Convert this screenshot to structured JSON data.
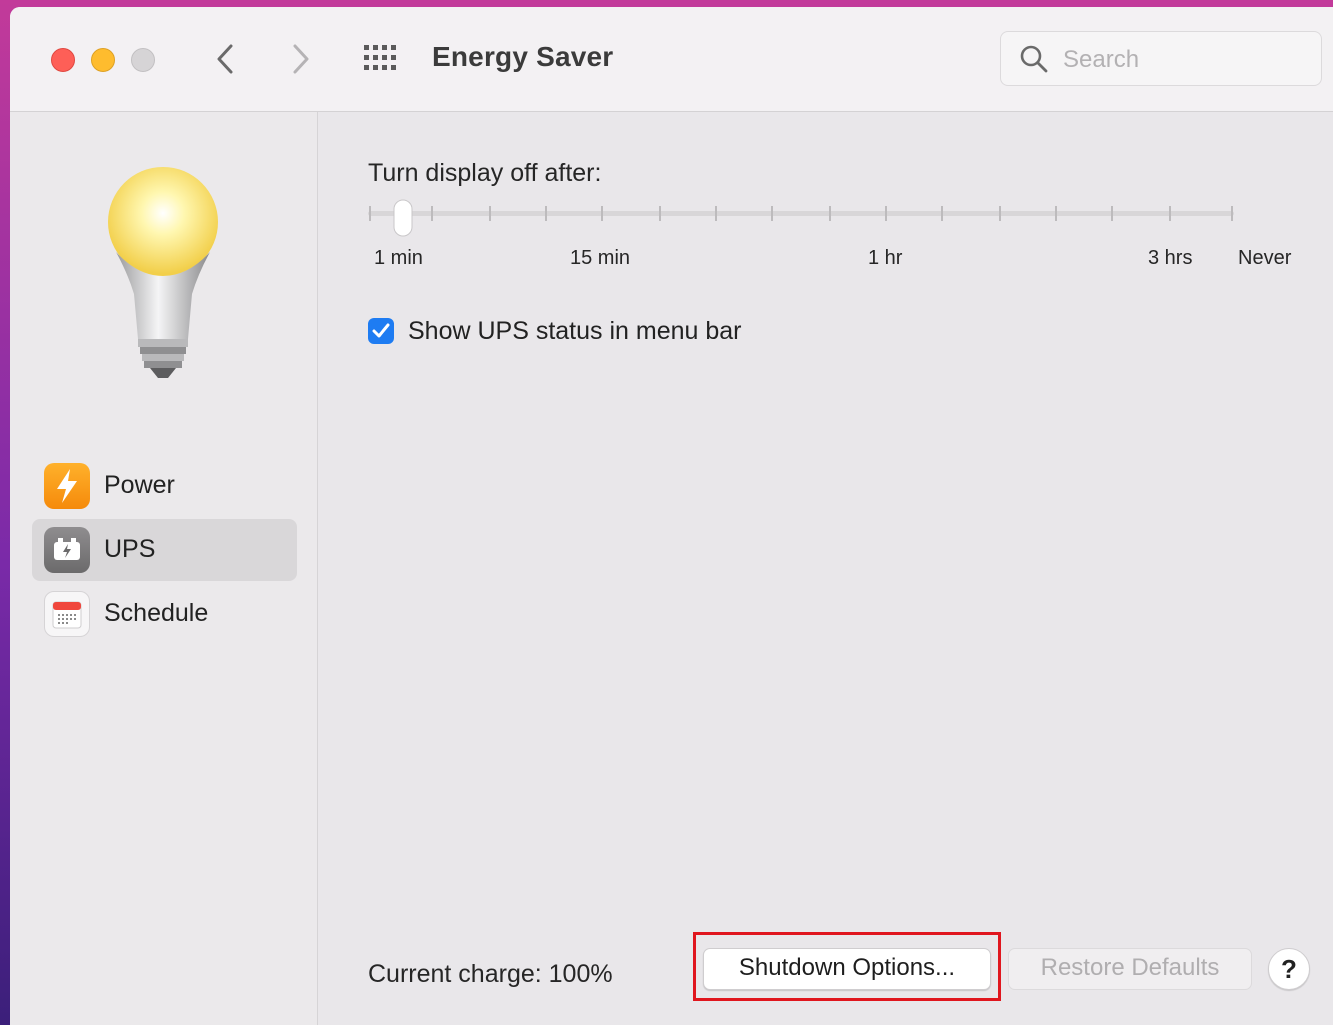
{
  "window": {
    "title": "Energy Saver",
    "search_placeholder": "Search"
  },
  "sidebar": {
    "items": [
      {
        "label": "Power",
        "icon": "lightning-icon",
        "selected": false
      },
      {
        "label": "UPS",
        "icon": "ups-battery-icon",
        "selected": true
      },
      {
        "label": "Schedule",
        "icon": "calendar-icon",
        "selected": false
      }
    ]
  },
  "display_sleep": {
    "label": "Turn display off after:",
    "tick_labels": [
      "1 min",
      "15 min",
      "1 hr",
      "3 hrs",
      "Never"
    ],
    "tick_count": 16,
    "value_label": "1 min"
  },
  "ups_status": {
    "label": "Show UPS status in menu bar",
    "checked": true
  },
  "footer": {
    "charge_text": "Current charge: 100%",
    "shutdown_button": "Shutdown Options...",
    "restore_button": "Restore Defaults",
    "help_button": "?"
  },
  "colors": {
    "accent": "#1e7cf2",
    "highlight_box": "#e0161e"
  }
}
